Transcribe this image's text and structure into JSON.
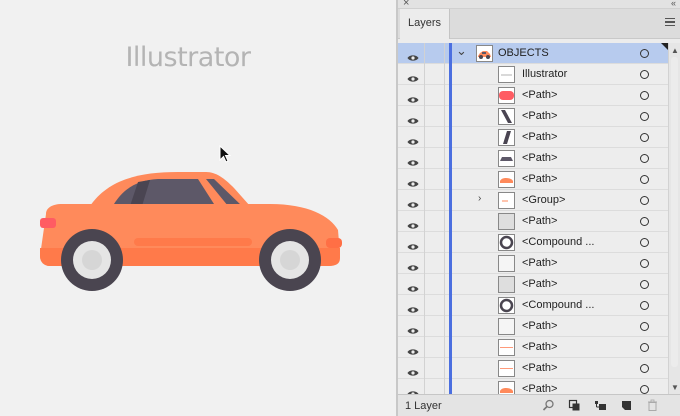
{
  "canvas": {
    "title": "Illustrator"
  },
  "panel": {
    "tab_label": "Layers",
    "footer": {
      "layer_count": "1 Layer"
    },
    "rows": [
      {
        "label": "OBJECTS",
        "level": 0,
        "expander": "down",
        "selected": true,
        "thumb": "car"
      },
      {
        "label": "Illustrator",
        "level": 1,
        "expander": "",
        "thumb": "text"
      },
      {
        "label": "<Path>",
        "level": 1,
        "expander": "",
        "thumb": "red-blob"
      },
      {
        "label": "<Path>",
        "level": 1,
        "expander": "",
        "thumb": "slash"
      },
      {
        "label": "<Path>",
        "level": 1,
        "expander": "",
        "thumb": "slash2"
      },
      {
        "label": "<Path>",
        "level": 1,
        "expander": "",
        "thumb": "trapezoid"
      },
      {
        "label": "<Path>",
        "level": 1,
        "expander": "",
        "thumb": "orange-bar"
      },
      {
        "label": "<Group>",
        "level": 1,
        "expander": "right",
        "thumb": "group"
      },
      {
        "label": "<Path>",
        "level": 1,
        "expander": "",
        "thumb": "grey"
      },
      {
        "label": "<Compound ...",
        "level": 1,
        "expander": "",
        "thumb": "ring"
      },
      {
        "label": "<Path>",
        "level": 1,
        "expander": "",
        "thumb": "light"
      },
      {
        "label": "<Path>",
        "level": 1,
        "expander": "",
        "thumb": "grey"
      },
      {
        "label": "<Compound ...",
        "level": 1,
        "expander": "",
        "thumb": "ring"
      },
      {
        "label": "<Path>",
        "level": 1,
        "expander": "",
        "thumb": "light"
      },
      {
        "label": "<Path>",
        "level": 1,
        "expander": "",
        "thumb": "line"
      },
      {
        "label": "<Path>",
        "level": 1,
        "expander": "",
        "thumb": "line"
      },
      {
        "label": "<Path>",
        "level": 1,
        "expander": "",
        "thumb": "orange-bar"
      }
    ]
  },
  "colors": {
    "layer_color": "#4b6fe0",
    "selected_row": "#b7cbee",
    "car_body": "#ff8a5b",
    "car_window": "#5d5868",
    "tire": "#4a4550"
  },
  "icons": [
    "close-icon",
    "collapse-icon",
    "panel-menu-icon",
    "eye-icon",
    "search-icon",
    "collect-icon",
    "new-sublayer-icon",
    "new-layer-icon",
    "trash-icon"
  ]
}
